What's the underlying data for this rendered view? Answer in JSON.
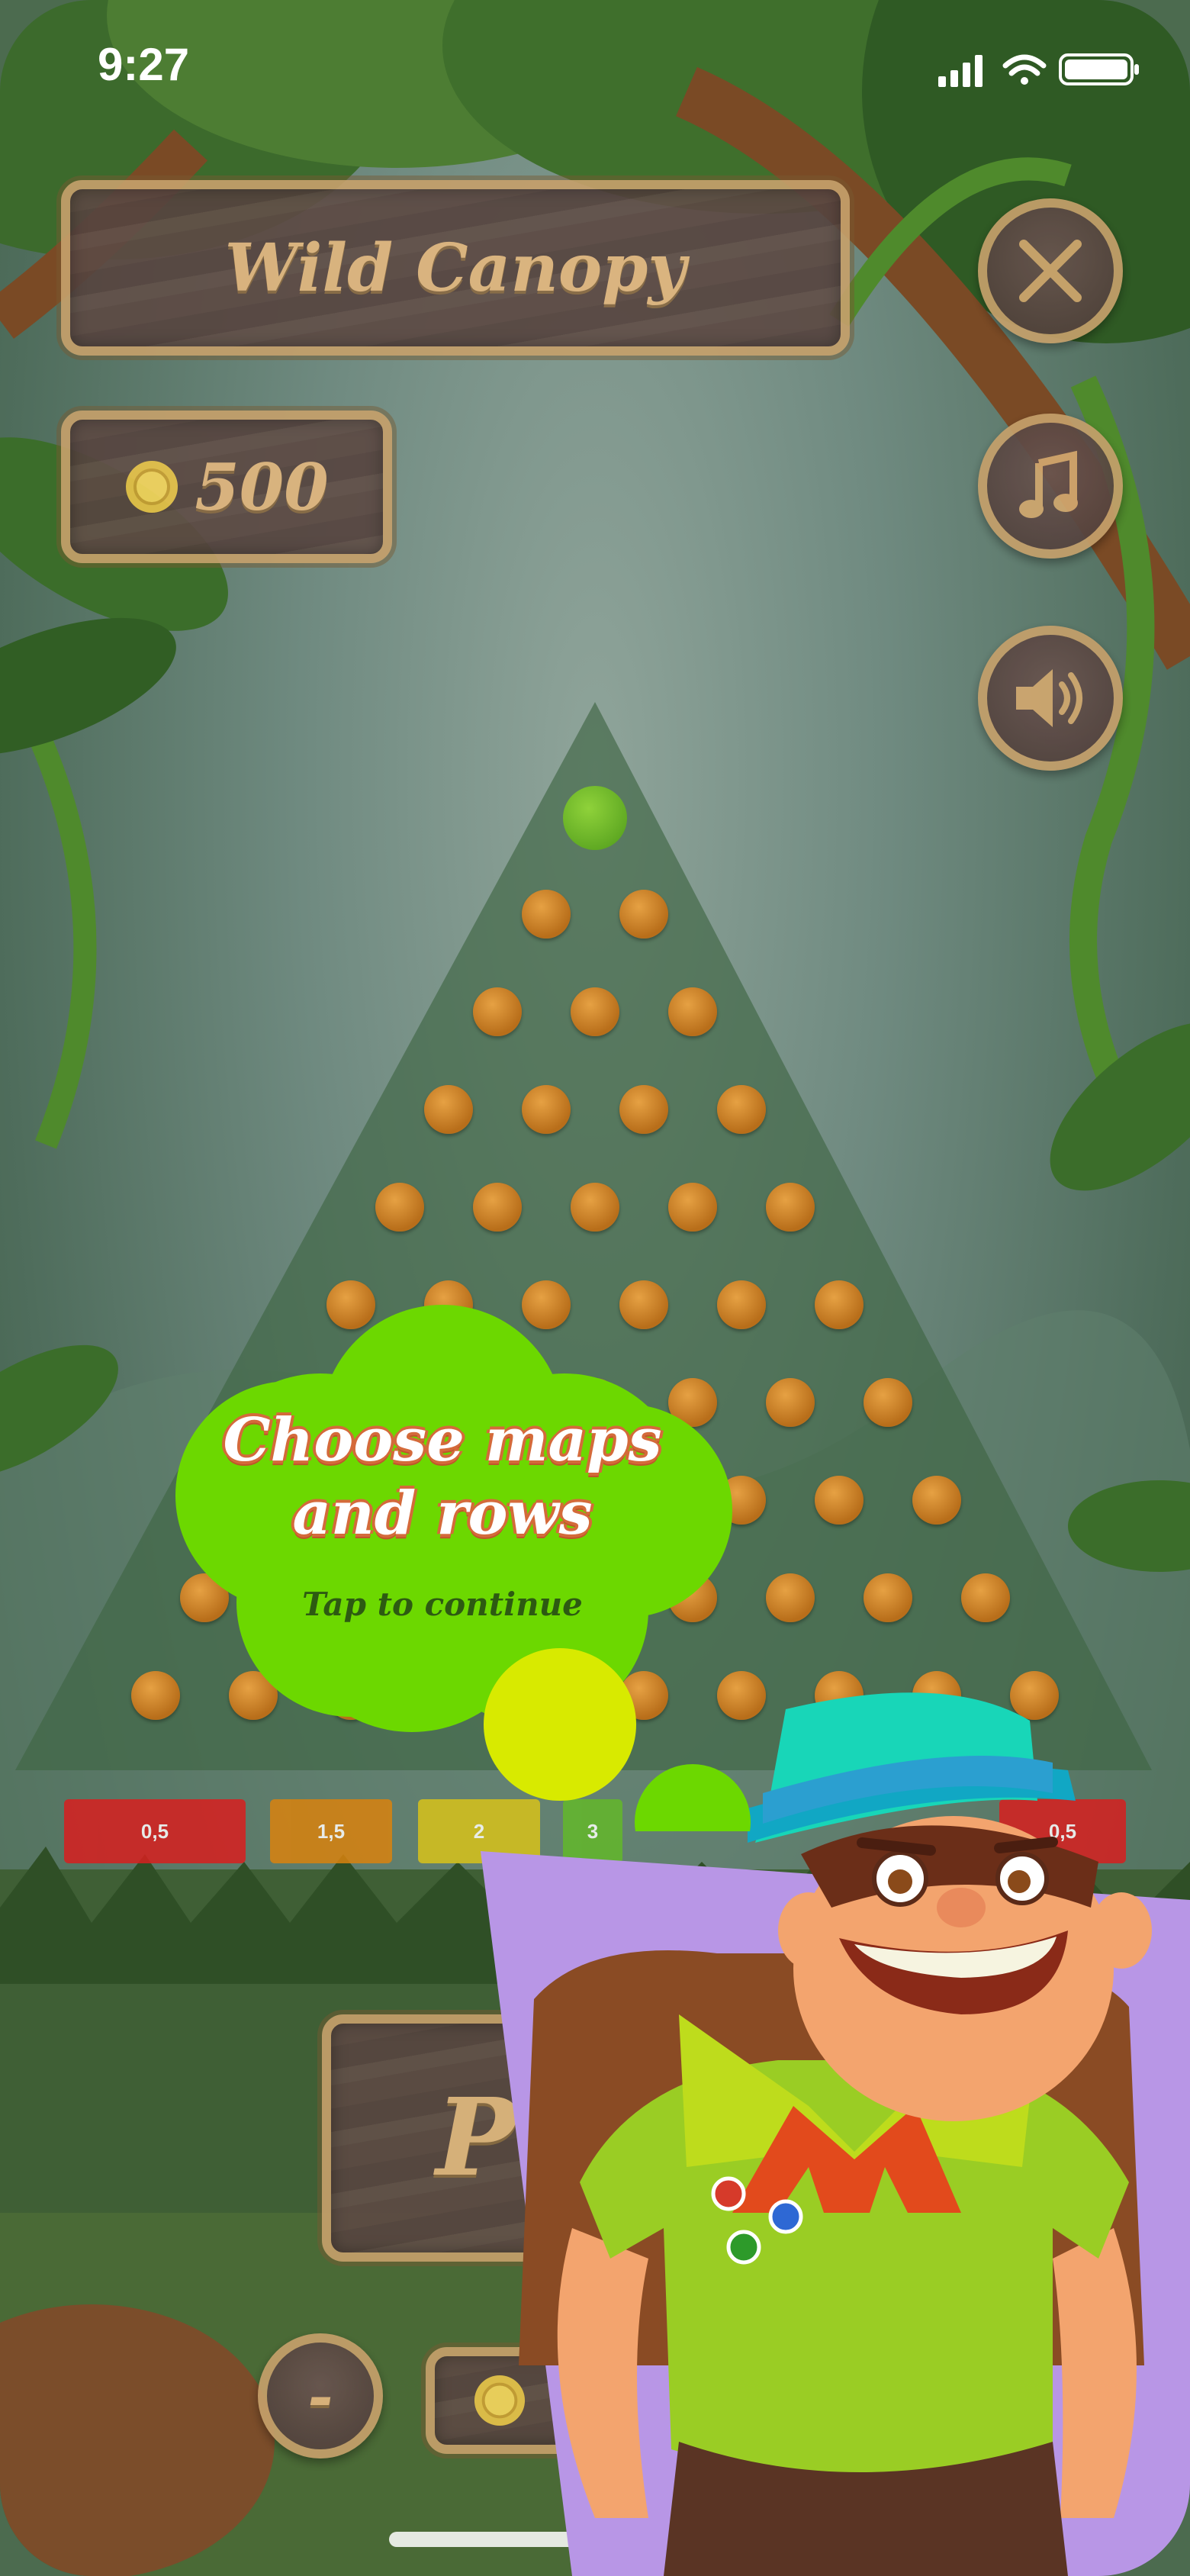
{
  "status_bar": {
    "time": "9:27"
  },
  "header": {
    "title": "Wild Canopy",
    "coins": "500"
  },
  "controls": {
    "close_icon": "close-icon",
    "music_icon": "music-icon",
    "sound_icon": "speaker-icon"
  },
  "board": {
    "multipliers": [
      "0,5",
      "1,5",
      "2",
      "3",
      "0,5"
    ],
    "multiplier_colors": [
      "#d81f1f",
      "#d9820e",
      "#d8c21a",
      "#63b82a",
      "#d81f1f"
    ]
  },
  "tutorial": {
    "message_line1": "Choose maps",
    "message_line2": "and rows",
    "tap_hint": "Tap to continue"
  },
  "bottom": {
    "play_label": "P",
    "minus_label": "-"
  },
  "colors": {
    "wood_border": "#c5a06b",
    "wood_fill": "#5d4a44",
    "bubble_green": "#6cd800",
    "bubble_yellow": "#d8ea00",
    "guide_bg": "#b896e6"
  }
}
